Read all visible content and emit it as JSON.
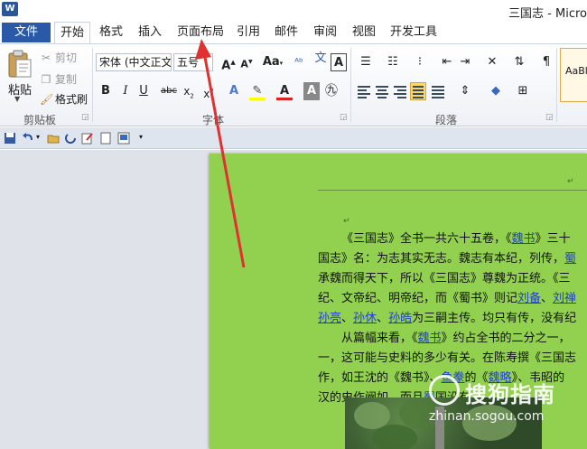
{
  "window": {
    "title": "三国志 - Micro"
  },
  "tabs": [
    "文件",
    "开始",
    "格式",
    "插入",
    "页面布局",
    "引用",
    "邮件",
    "审阅",
    "视图",
    "开发工具"
  ],
  "ribbon": {
    "clipboard": {
      "paste": "粘贴",
      "cut": "剪切",
      "copy": "复制",
      "format_painter": "格式刷",
      "label": "剪贴板"
    },
    "font": {
      "name": "宋体 (中文正文",
      "size": "五号",
      "label": "字体"
    },
    "paragraph": {
      "label": "段落"
    },
    "styles": {
      "sample": "AaBl"
    }
  },
  "document": {
    "lines": [
      [
        "《三国志》全书一共六十五卷，《",
        {
          "link": "魏书"
        },
        "》三十"
      ],
      [
        "国志》名：为志其实无志。魏志有本纪，列传，",
        {
          "link": "蜀"
        }
      ],
      [
        "承魏而得天下，所以《三国志》尊魏为正统。《三"
      ],
      [
        "纪、文帝纪、明帝纪，而《蜀书》则记",
        {
          "link": "刘备"
        },
        "、",
        {
          "link": "刘禅"
        }
      ],
      [
        {
          "link": "孙亮"
        },
        "、",
        {
          "link": "孙休"
        },
        "、",
        {
          "link": "孙皓"
        },
        "为三嗣主传。均只有传，没有纪"
      ],
      [
        "从篇幅来看，《",
        {
          "link": "魏书"
        },
        "》约占全书的二分之一，"
      ],
      [
        "一，这可能与史料的多少有关。在陈寿撰《三国志"
      ],
      [
        "作，如王沈的《魏书》、",
        {
          "link": "鱼豢"
        },
        "的《",
        {
          "link": "魏略"
        },
        "》、韦昭的"
      ],
      [
        "汉的史作阙如，而且",
        {
          "link": "蜀"
        },
        "国没有"
      ]
    ]
  },
  "watermark": {
    "brand": "搜狗指南",
    "url": "zhinan.sogou.com"
  },
  "colors": {
    "page_background": "#92d050",
    "file_tab": "#2a5aa7",
    "link": "#1f3fd1",
    "arrow": "#e03030"
  }
}
